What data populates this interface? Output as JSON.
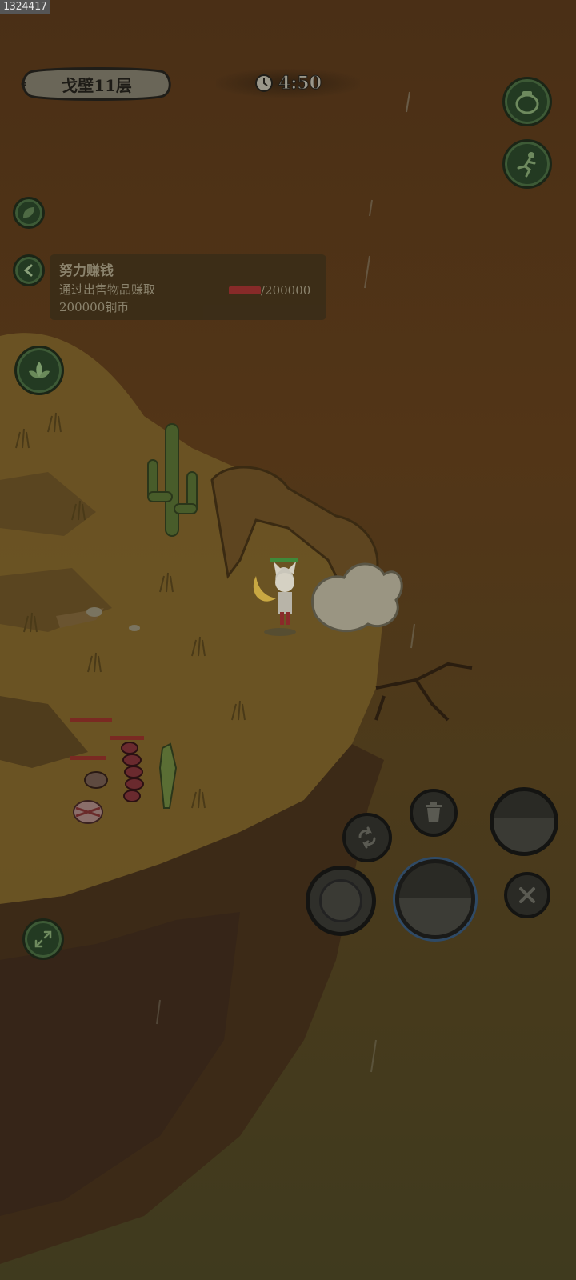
{
  "watermark": "1324417",
  "hud": {
    "level_label": "戈壁11层",
    "timer": "4:50"
  },
  "quest": {
    "title": "努力赚钱",
    "description_line1": "通过出售物品赚取",
    "description_line2": "200000铜币",
    "progress_current": "",
    "progress_total": "/200000"
  },
  "icons": {
    "pot": "pot-icon",
    "running": "running-man-icon",
    "leaf": "leaf-icon",
    "back": "chevron-left-icon",
    "lotus": "lotus-icon",
    "expand": "expand-arrows-icon",
    "swap": "swap-arrows-icon",
    "trash": "trash-icon",
    "close": "close-icon"
  },
  "colors": {
    "accent_green": "#3d5a36",
    "progress_red": "#8a2a2a",
    "panel_bg": "#3b2d18"
  }
}
